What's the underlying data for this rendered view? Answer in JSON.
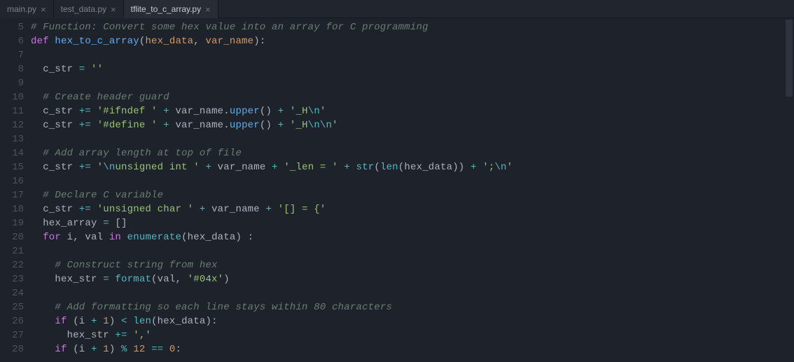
{
  "tabs": [
    {
      "label": "main.py",
      "active": false
    },
    {
      "label": "test_data.py",
      "active": false
    },
    {
      "label": "tflite_to_c_array.py",
      "active": true
    }
  ],
  "first_line_number": 5,
  "lines": [
    [
      {
        "cls": "tok-comment",
        "text": "# Function: Convert some hex value into an array for C programming"
      }
    ],
    [
      {
        "cls": "tok-keyword",
        "text": "def "
      },
      {
        "cls": "tok-def",
        "text": "hex_to_c_array"
      },
      {
        "cls": "tok-plain",
        "text": "("
      },
      {
        "cls": "tok-param",
        "text": "hex_data"
      },
      {
        "cls": "tok-plain",
        "text": ", "
      },
      {
        "cls": "tok-param",
        "text": "var_name"
      },
      {
        "cls": "tok-plain",
        "text": "):"
      }
    ],
    [
      {
        "cls": "tok-plain",
        "text": ""
      }
    ],
    [
      {
        "cls": "tok-plain",
        "text": "  c_str "
      },
      {
        "cls": "tok-op",
        "text": "="
      },
      {
        "cls": "tok-plain",
        "text": " "
      },
      {
        "cls": "tok-string",
        "text": "''"
      }
    ],
    [
      {
        "cls": "tok-plain",
        "text": ""
      }
    ],
    [
      {
        "cls": "tok-plain",
        "text": "  "
      },
      {
        "cls": "tok-comment",
        "text": "# Create header guard"
      }
    ],
    [
      {
        "cls": "tok-plain",
        "text": "  c_str "
      },
      {
        "cls": "tok-op",
        "text": "+="
      },
      {
        "cls": "tok-plain",
        "text": " "
      },
      {
        "cls": "tok-string",
        "text": "'#ifndef '"
      },
      {
        "cls": "tok-plain",
        "text": " "
      },
      {
        "cls": "tok-op",
        "text": "+"
      },
      {
        "cls": "tok-plain",
        "text": " var_name."
      },
      {
        "cls": "tok-func",
        "text": "upper"
      },
      {
        "cls": "tok-plain",
        "text": "() "
      },
      {
        "cls": "tok-op",
        "text": "+"
      },
      {
        "cls": "tok-plain",
        "text": " "
      },
      {
        "cls": "tok-string",
        "text": "'_H"
      },
      {
        "cls": "tok-escape",
        "text": "\\n"
      },
      {
        "cls": "tok-string",
        "text": "'"
      }
    ],
    [
      {
        "cls": "tok-plain",
        "text": "  c_str "
      },
      {
        "cls": "tok-op",
        "text": "+="
      },
      {
        "cls": "tok-plain",
        "text": " "
      },
      {
        "cls": "tok-string",
        "text": "'#define '"
      },
      {
        "cls": "tok-plain",
        "text": " "
      },
      {
        "cls": "tok-op",
        "text": "+"
      },
      {
        "cls": "tok-plain",
        "text": " var_name."
      },
      {
        "cls": "tok-func",
        "text": "upper"
      },
      {
        "cls": "tok-plain",
        "text": "() "
      },
      {
        "cls": "tok-op",
        "text": "+"
      },
      {
        "cls": "tok-plain",
        "text": " "
      },
      {
        "cls": "tok-string",
        "text": "'_H"
      },
      {
        "cls": "tok-escape",
        "text": "\\n\\n"
      },
      {
        "cls": "tok-string",
        "text": "'"
      }
    ],
    [
      {
        "cls": "tok-plain",
        "text": ""
      }
    ],
    [
      {
        "cls": "tok-plain",
        "text": "  "
      },
      {
        "cls": "tok-comment",
        "text": "# Add array length at top of file"
      }
    ],
    [
      {
        "cls": "tok-plain",
        "text": "  c_str "
      },
      {
        "cls": "tok-op",
        "text": "+="
      },
      {
        "cls": "tok-plain",
        "text": " "
      },
      {
        "cls": "tok-string",
        "text": "'"
      },
      {
        "cls": "tok-escape",
        "text": "\\n"
      },
      {
        "cls": "tok-string",
        "text": "unsigned int '"
      },
      {
        "cls": "tok-plain",
        "text": " "
      },
      {
        "cls": "tok-op",
        "text": "+"
      },
      {
        "cls": "tok-plain",
        "text": " var_name "
      },
      {
        "cls": "tok-op",
        "text": "+"
      },
      {
        "cls": "tok-plain",
        "text": " "
      },
      {
        "cls": "tok-string",
        "text": "'_len = '"
      },
      {
        "cls": "tok-plain",
        "text": " "
      },
      {
        "cls": "tok-op",
        "text": "+"
      },
      {
        "cls": "tok-plain",
        "text": " "
      },
      {
        "cls": "tok-builtin",
        "text": "str"
      },
      {
        "cls": "tok-plain",
        "text": "("
      },
      {
        "cls": "tok-builtin",
        "text": "len"
      },
      {
        "cls": "tok-plain",
        "text": "(hex_data)) "
      },
      {
        "cls": "tok-op",
        "text": "+"
      },
      {
        "cls": "tok-plain",
        "text": " "
      },
      {
        "cls": "tok-string",
        "text": "';"
      },
      {
        "cls": "tok-escape",
        "text": "\\n"
      },
      {
        "cls": "tok-string",
        "text": "'"
      }
    ],
    [
      {
        "cls": "tok-plain",
        "text": ""
      }
    ],
    [
      {
        "cls": "tok-plain",
        "text": "  "
      },
      {
        "cls": "tok-comment",
        "text": "# Declare C variable"
      }
    ],
    [
      {
        "cls": "tok-plain",
        "text": "  c_str "
      },
      {
        "cls": "tok-op",
        "text": "+="
      },
      {
        "cls": "tok-plain",
        "text": " "
      },
      {
        "cls": "tok-string",
        "text": "'unsigned char '"
      },
      {
        "cls": "tok-plain",
        "text": " "
      },
      {
        "cls": "tok-op",
        "text": "+"
      },
      {
        "cls": "tok-plain",
        "text": " var_name "
      },
      {
        "cls": "tok-op",
        "text": "+"
      },
      {
        "cls": "tok-plain",
        "text": " "
      },
      {
        "cls": "tok-string",
        "text": "'[] = {'"
      }
    ],
    [
      {
        "cls": "tok-plain",
        "text": "  hex_array "
      },
      {
        "cls": "tok-op",
        "text": "="
      },
      {
        "cls": "tok-plain",
        "text": " []"
      }
    ],
    [
      {
        "cls": "tok-plain",
        "text": "  "
      },
      {
        "cls": "tok-keyword",
        "text": "for"
      },
      {
        "cls": "tok-plain",
        "text": " i, val "
      },
      {
        "cls": "tok-keyword",
        "text": "in"
      },
      {
        "cls": "tok-plain",
        "text": " "
      },
      {
        "cls": "tok-builtin",
        "text": "enumerate"
      },
      {
        "cls": "tok-plain",
        "text": "(hex_data) :"
      }
    ],
    [
      {
        "cls": "tok-plain",
        "text": ""
      }
    ],
    [
      {
        "cls": "tok-plain",
        "text": "    "
      },
      {
        "cls": "tok-comment",
        "text": "# Construct string from hex"
      }
    ],
    [
      {
        "cls": "tok-plain",
        "text": "    hex_str "
      },
      {
        "cls": "tok-op",
        "text": "="
      },
      {
        "cls": "tok-plain",
        "text": " "
      },
      {
        "cls": "tok-builtin",
        "text": "format"
      },
      {
        "cls": "tok-plain",
        "text": "(val, "
      },
      {
        "cls": "tok-string",
        "text": "'#04x'"
      },
      {
        "cls": "tok-plain",
        "text": ")"
      }
    ],
    [
      {
        "cls": "tok-plain",
        "text": ""
      }
    ],
    [
      {
        "cls": "tok-plain",
        "text": "    "
      },
      {
        "cls": "tok-comment",
        "text": "# Add formatting so each line stays within 80 characters"
      }
    ],
    [
      {
        "cls": "tok-plain",
        "text": "    "
      },
      {
        "cls": "tok-keyword",
        "text": "if"
      },
      {
        "cls": "tok-plain",
        "text": " (i "
      },
      {
        "cls": "tok-op",
        "text": "+"
      },
      {
        "cls": "tok-plain",
        "text": " "
      },
      {
        "cls": "tok-number",
        "text": "1"
      },
      {
        "cls": "tok-plain",
        "text": ") "
      },
      {
        "cls": "tok-op",
        "text": "<"
      },
      {
        "cls": "tok-plain",
        "text": " "
      },
      {
        "cls": "tok-builtin",
        "text": "len"
      },
      {
        "cls": "tok-plain",
        "text": "(hex_data):"
      }
    ],
    [
      {
        "cls": "tok-plain",
        "text": "      hex_str "
      },
      {
        "cls": "tok-op",
        "text": "+="
      },
      {
        "cls": "tok-plain",
        "text": " "
      },
      {
        "cls": "tok-string",
        "text": "','"
      }
    ],
    [
      {
        "cls": "tok-plain",
        "text": "    "
      },
      {
        "cls": "tok-keyword",
        "text": "if"
      },
      {
        "cls": "tok-plain",
        "text": " (i "
      },
      {
        "cls": "tok-op",
        "text": "+"
      },
      {
        "cls": "tok-plain",
        "text": " "
      },
      {
        "cls": "tok-number",
        "text": "1"
      },
      {
        "cls": "tok-plain",
        "text": ") "
      },
      {
        "cls": "tok-op",
        "text": "%"
      },
      {
        "cls": "tok-plain",
        "text": " "
      },
      {
        "cls": "tok-number",
        "text": "12"
      },
      {
        "cls": "tok-plain",
        "text": " "
      },
      {
        "cls": "tok-op",
        "text": "=="
      },
      {
        "cls": "tok-plain",
        "text": " "
      },
      {
        "cls": "tok-number",
        "text": "0"
      },
      {
        "cls": "tok-plain",
        "text": ":"
      }
    ]
  ]
}
